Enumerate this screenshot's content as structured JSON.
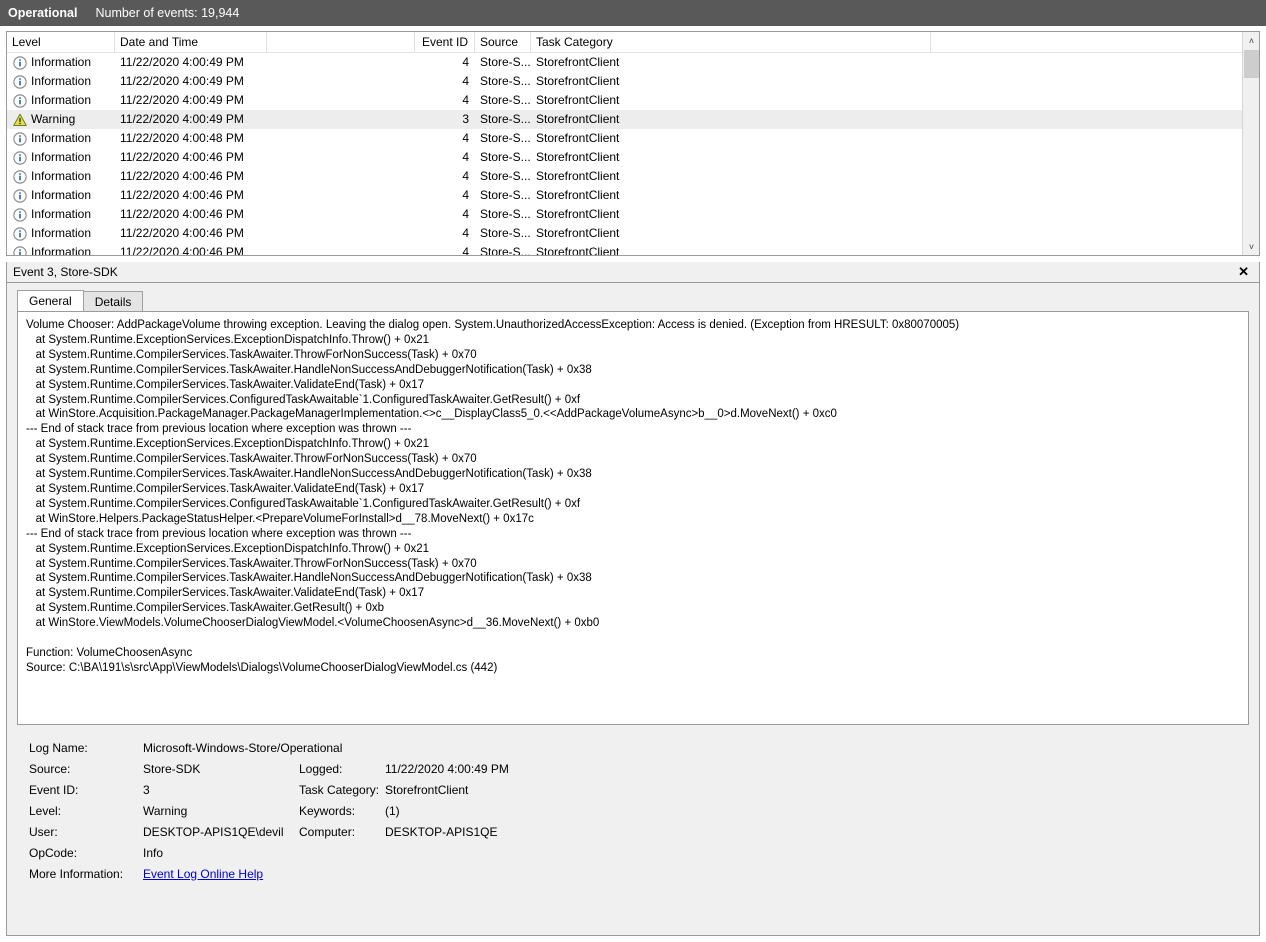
{
  "titlebar": {
    "log_name": "Operational",
    "event_count_label": "Number of events: 19,944"
  },
  "event_list": {
    "columns": [
      {
        "key": "level",
        "label": "Level"
      },
      {
        "key": "datetime",
        "label": "Date and Time"
      },
      {
        "key": "spacer",
        "label": ""
      },
      {
        "key": "event_id",
        "label": "Event ID"
      },
      {
        "key": "source",
        "label": "Source"
      },
      {
        "key": "task_category",
        "label": "Task Category"
      }
    ],
    "rows": [
      {
        "icon": "information-icon",
        "level": "Information",
        "datetime": "11/22/2020 4:00:49 PM",
        "event_id": "4",
        "source": "Store-S...",
        "task_category": "StorefrontClient",
        "selected": false
      },
      {
        "icon": "information-icon",
        "level": "Information",
        "datetime": "11/22/2020 4:00:49 PM",
        "event_id": "4",
        "source": "Store-S...",
        "task_category": "StorefrontClient",
        "selected": false
      },
      {
        "icon": "information-icon",
        "level": "Information",
        "datetime": "11/22/2020 4:00:49 PM",
        "event_id": "4",
        "source": "Store-S...",
        "task_category": "StorefrontClient",
        "selected": false
      },
      {
        "icon": "warning-icon",
        "level": "Warning",
        "datetime": "11/22/2020 4:00:49 PM",
        "event_id": "3",
        "source": "Store-S...",
        "task_category": "StorefrontClient",
        "selected": true
      },
      {
        "icon": "information-icon",
        "level": "Information",
        "datetime": "11/22/2020 4:00:48 PM",
        "event_id": "4",
        "source": "Store-S...",
        "task_category": "StorefrontClient",
        "selected": false
      },
      {
        "icon": "information-icon",
        "level": "Information",
        "datetime": "11/22/2020 4:00:46 PM",
        "event_id": "4",
        "source": "Store-S...",
        "task_category": "StorefrontClient",
        "selected": false
      },
      {
        "icon": "information-icon",
        "level": "Information",
        "datetime": "11/22/2020 4:00:46 PM",
        "event_id": "4",
        "source": "Store-S...",
        "task_category": "StorefrontClient",
        "selected": false
      },
      {
        "icon": "information-icon",
        "level": "Information",
        "datetime": "11/22/2020 4:00:46 PM",
        "event_id": "4",
        "source": "Store-S...",
        "task_category": "StorefrontClient",
        "selected": false
      },
      {
        "icon": "information-icon",
        "level": "Information",
        "datetime": "11/22/2020 4:00:46 PM",
        "event_id": "4",
        "source": "Store-S...",
        "task_category": "StorefrontClient",
        "selected": false
      },
      {
        "icon": "information-icon",
        "level": "Information",
        "datetime": "11/22/2020 4:00:46 PM",
        "event_id": "4",
        "source": "Store-S...",
        "task_category": "StorefrontClient",
        "selected": false
      },
      {
        "icon": "information-icon",
        "level": "Information",
        "datetime": "11/22/2020 4:00:46 PM",
        "event_id": "4",
        "source": "Store-S...",
        "task_category": "StorefrontClient",
        "selected": false
      }
    ]
  },
  "detail": {
    "title": "Event 3, Store-SDK",
    "close_label": "✕",
    "tabs": [
      {
        "label": "General",
        "active": true
      },
      {
        "label": "Details",
        "active": false
      }
    ],
    "description": "Volume Chooser: AddPackageVolume throwing exception. Leaving the dialog open. System.UnauthorizedAccessException: Access is denied. (Exception from HRESULT: 0x80070005)\n   at System.Runtime.ExceptionServices.ExceptionDispatchInfo.Throw() + 0x21\n   at System.Runtime.CompilerServices.TaskAwaiter.ThrowForNonSuccess(Task) + 0x70\n   at System.Runtime.CompilerServices.TaskAwaiter.HandleNonSuccessAndDebuggerNotification(Task) + 0x38\n   at System.Runtime.CompilerServices.TaskAwaiter.ValidateEnd(Task) + 0x17\n   at System.Runtime.CompilerServices.ConfiguredTaskAwaitable`1.ConfiguredTaskAwaiter.GetResult() + 0xf\n   at WinStore.Acquisition.PackageManager.PackageManagerImplementation.<>c__DisplayClass5_0.<<AddPackageVolumeAsync>b__0>d.MoveNext() + 0xc0\n--- End of stack trace from previous location where exception was thrown ---\n   at System.Runtime.ExceptionServices.ExceptionDispatchInfo.Throw() + 0x21\n   at System.Runtime.CompilerServices.TaskAwaiter.ThrowForNonSuccess(Task) + 0x70\n   at System.Runtime.CompilerServices.TaskAwaiter.HandleNonSuccessAndDebuggerNotification(Task) + 0x38\n   at System.Runtime.CompilerServices.TaskAwaiter.ValidateEnd(Task) + 0x17\n   at System.Runtime.CompilerServices.ConfiguredTaskAwaitable`1.ConfiguredTaskAwaiter.GetResult() + 0xf\n   at WinStore.Helpers.PackageStatusHelper.<PrepareVolumeForInstall>d__78.MoveNext() + 0x17c\n--- End of stack trace from previous location where exception was thrown ---\n   at System.Runtime.ExceptionServices.ExceptionDispatchInfo.Throw() + 0x21\n   at System.Runtime.CompilerServices.TaskAwaiter.ThrowForNonSuccess(Task) + 0x70\n   at System.Runtime.CompilerServices.TaskAwaiter.HandleNonSuccessAndDebuggerNotification(Task) + 0x38\n   at System.Runtime.CompilerServices.TaskAwaiter.ValidateEnd(Task) + 0x17\n   at System.Runtime.CompilerServices.TaskAwaiter.GetResult() + 0xb\n   at WinStore.ViewModels.VolumeChooserDialogViewModel.<VolumeChoosenAsync>d__36.MoveNext() + 0xb0\n\nFunction: VolumeChoosenAsync\nSource: C:\\BA\\191\\s\\src\\App\\ViewModels\\Dialogs\\VolumeChooserDialogViewModel.cs (442)",
    "metadata": {
      "log_name_label": "Log Name:",
      "log_name_value": "Microsoft-Windows-Store/Operational",
      "source_label": "Source:",
      "source_value": "Store-SDK",
      "logged_label": "Logged:",
      "logged_value": "11/22/2020 4:00:49 PM",
      "event_id_label": "Event ID:",
      "event_id_value": "3",
      "task_category_label": "Task Category:",
      "task_category_value": "StorefrontClient",
      "level_label": "Level:",
      "level_value": "Warning",
      "keywords_label": "Keywords:",
      "keywords_value": "(1)",
      "user_label": "User:",
      "user_value": "DESKTOP-APIS1QE\\devil",
      "computer_label": "Computer:",
      "computer_value": "DESKTOP-APIS1QE",
      "opcode_label": "OpCode:",
      "opcode_value": "Info",
      "more_info_label": "More Information:",
      "more_info_link": "Event Log Online Help"
    }
  },
  "scrollbar": {
    "up_arrow": "˄",
    "down_arrow": "˅"
  },
  "colors": {
    "titlebar_bg": "#595959",
    "selection_bg": "#ededed",
    "link": "#0000cc",
    "warning": "#d9c334",
    "information": "#3c78b4"
  }
}
